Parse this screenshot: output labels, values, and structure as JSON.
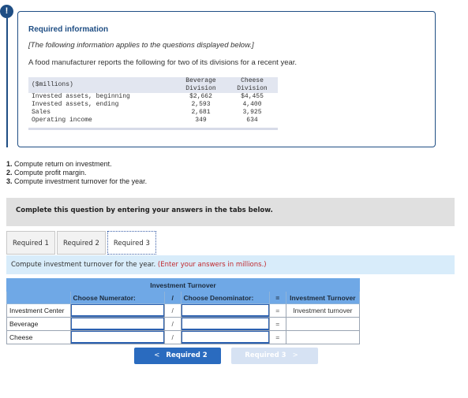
{
  "info": {
    "badge": "!",
    "title": "Required information",
    "note": "[The following information applies to the questions displayed below.]",
    "text": "A food manufacturer reports the following for two of its divisions for a recent year."
  },
  "data_table": {
    "unit_label": "($millions)",
    "col1_line1": "Beverage",
    "col1_line2": "Division",
    "col2_line1": "Cheese",
    "col2_line2": "Division",
    "rows": [
      {
        "label": "Invested assets, beginning",
        "beverage": "$2,662",
        "cheese": "$4,455"
      },
      {
        "label": "Invested assets, ending",
        "beverage": "2,593",
        "cheese": "4,400"
      },
      {
        "label": "Sales",
        "beverage": "2,681",
        "cheese": "3,925"
      },
      {
        "label": "Operating income",
        "beverage": "349",
        "cheese": "634"
      }
    ]
  },
  "questions": [
    {
      "num": "1.",
      "text": " Compute return on investment."
    },
    {
      "num": "2.",
      "text": " Compute profit margin."
    },
    {
      "num": "3.",
      "text": " Compute investment turnover for the year."
    }
  ],
  "complete_bar": "Complete this question by entering your answers in the tabs below.",
  "tabs": [
    {
      "label": "Required 1"
    },
    {
      "label": "Required 2"
    },
    {
      "label": "Required 3"
    }
  ],
  "prompt": {
    "text": "Compute investment turnover for the year. ",
    "highlight": "(Enter your answers in millions.)"
  },
  "turnover_table": {
    "title": "Investment Turnover",
    "numerator_header": "Choose Numerator:",
    "divide_op": "/",
    "denominator_header": "Choose Denominator:",
    "equals_op": "=",
    "result_header": "Investment Turnover",
    "rows": [
      {
        "label": "Investment Center",
        "numerator": "",
        "denominator": "",
        "result": "Investment turnover"
      },
      {
        "label": "Beverage",
        "numerator": "",
        "denominator": "",
        "result": ""
      },
      {
        "label": "Cheese",
        "numerator": "",
        "denominator": "",
        "result": ""
      }
    ]
  },
  "nav": {
    "prev_label": "Required 2",
    "prev_chevron": "<",
    "next_label": "Required 3",
    "next_chevron": ">"
  }
}
